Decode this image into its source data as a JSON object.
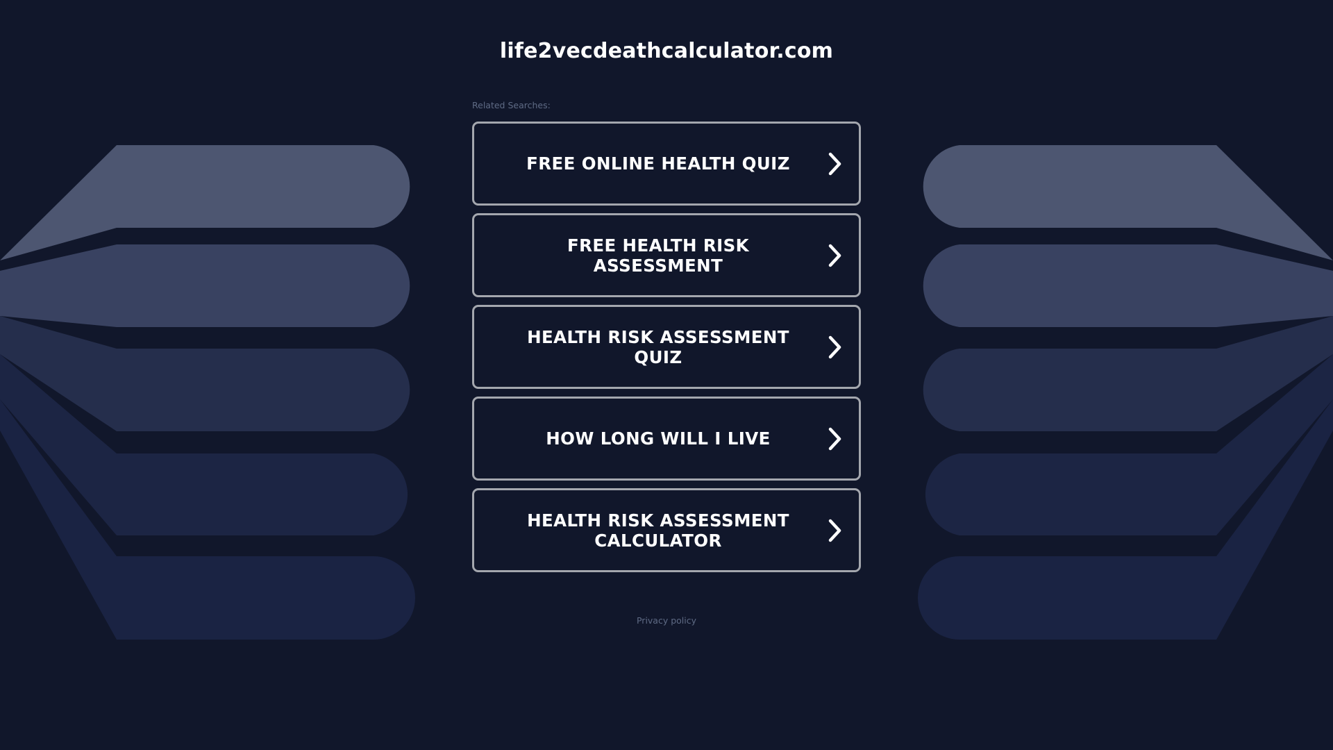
{
  "site": {
    "title": "life2vecdeathcalculator.com"
  },
  "related": {
    "label": "Related Searches:",
    "items": [
      {
        "label": "FREE ONLINE HEALTH QUIZ"
      },
      {
        "label": "FREE HEALTH RISK ASSESSMENT"
      },
      {
        "label": "HEALTH RISK ASSESSMENT QUIZ"
      },
      {
        "label": "HOW LONG WILL I LIVE"
      },
      {
        "label": "HEALTH RISK ASSESSMENT CALCULATOR"
      }
    ]
  },
  "footer": {
    "privacy_label": "Privacy policy"
  },
  "icons": {
    "item_arrow": "chevron-right-icon"
  },
  "colors": {
    "background": "#11172b",
    "button_border": "#a4a7ae",
    "text": "#ffffff",
    "muted_text": "#5f6b85",
    "band_1": "#4d5671",
    "band_2": "#394261",
    "band_3": "#262f4d",
    "band_4": "#1d2544",
    "band_5": "#1b2443"
  }
}
